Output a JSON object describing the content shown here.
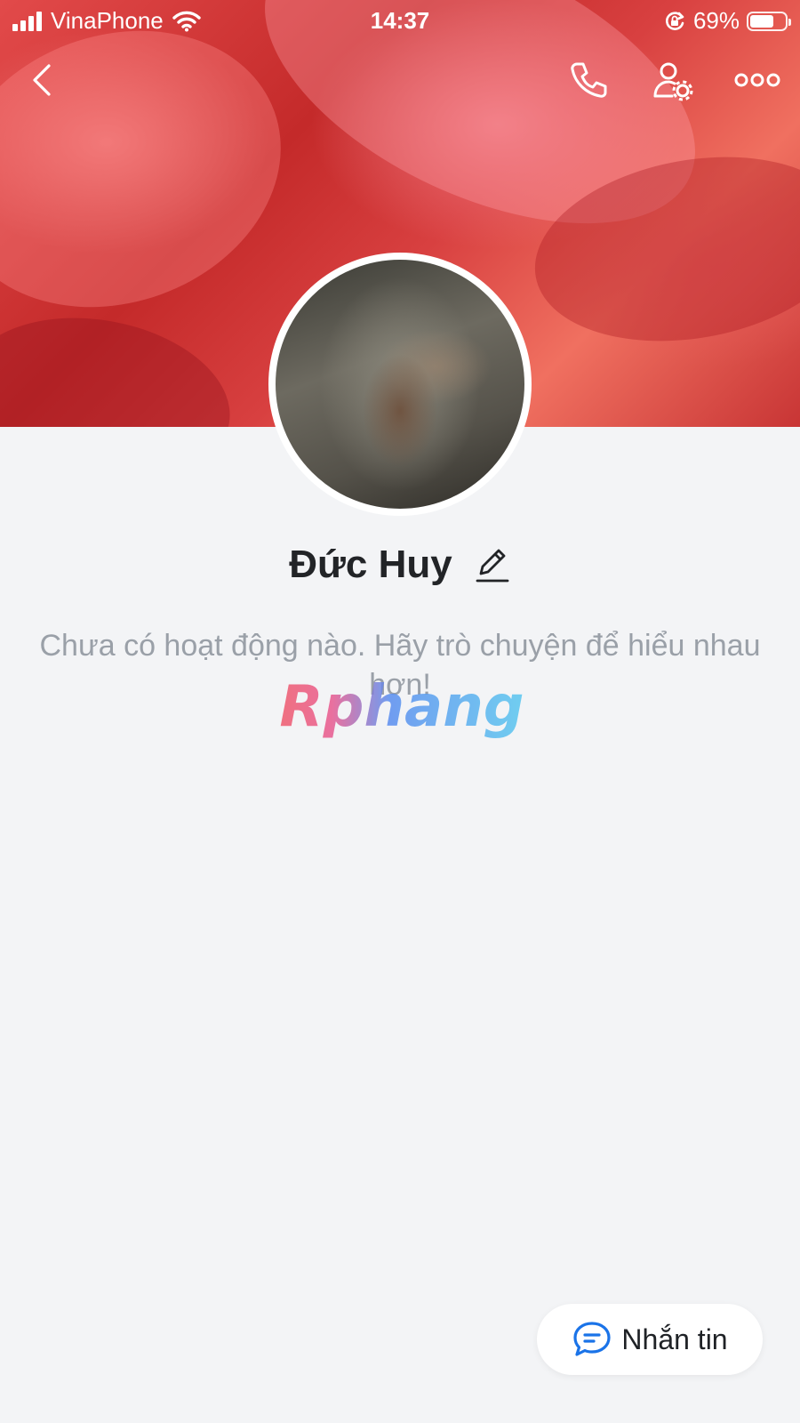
{
  "status_bar": {
    "carrier": "VinaPhone",
    "time": "14:37",
    "battery_percent": "69%",
    "battery_level": 0.69,
    "signal_icon": "signal-bars-icon",
    "wifi_icon": "wifi-icon",
    "rotation_lock_icon": "rotation-lock-icon"
  },
  "header": {
    "back_icon": "chevron-left-icon",
    "call_icon": "phone-icon",
    "manage_icon": "user-settings-icon",
    "more_icon": "more-horizontal-icon"
  },
  "profile": {
    "name": "Đức Huy",
    "edit_icon": "pencil-icon"
  },
  "feed": {
    "empty_message": "Chưa có hoạt động nào. Hãy trò chuyện để hiểu nhau hơn!"
  },
  "watermark": {
    "text": "Rphang"
  },
  "message_button": {
    "label": "Nhắn tin",
    "icon": "chat-bubble-icon"
  },
  "colors": {
    "background": "#f3f4f6",
    "primary_text": "#222427",
    "muted_text": "#9aa0a8",
    "accent_blue": "#1a73e8"
  }
}
